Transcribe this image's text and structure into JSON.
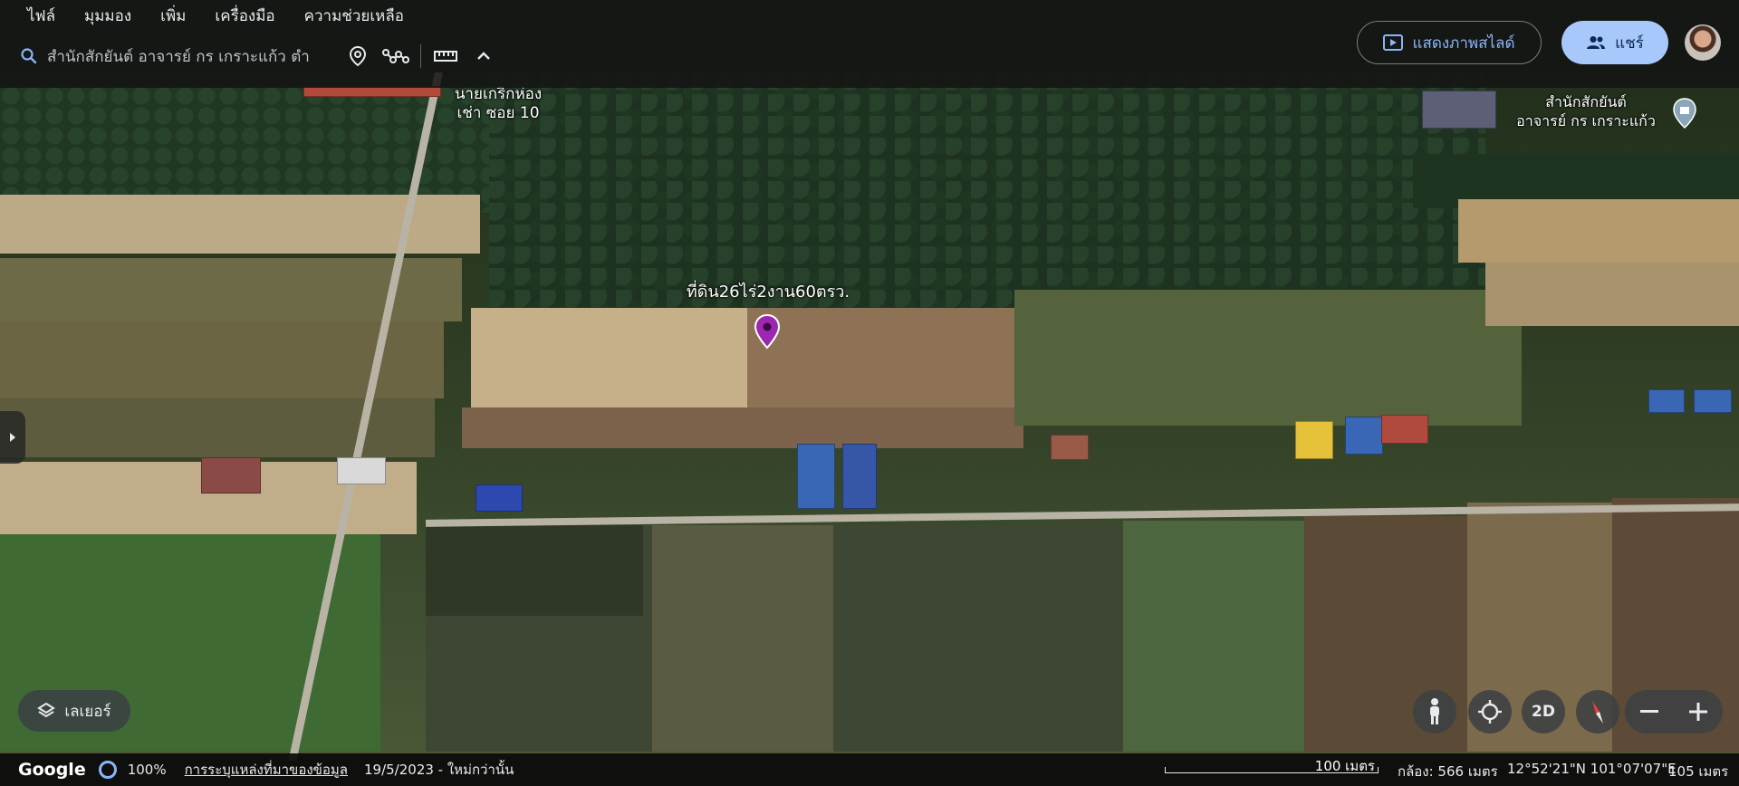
{
  "menu": {
    "items": [
      "ไฟล์",
      "มุมมอง",
      "เพิ่ม",
      "เครื่องมือ",
      "ความช่วยเหลือ"
    ]
  },
  "search": {
    "value": "สำนักสักยันต์ อาจารย์ กร เกราะแก้ว ตำ",
    "icons": [
      "search-icon",
      "location-pin-icon",
      "route-icon",
      "ruler-icon",
      "chevron-up-icon"
    ]
  },
  "header": {
    "slideshow_label": "แสดงภาพสไลด์",
    "share_label": "แชร์"
  },
  "map_labels": {
    "road_label": "นายเกริกห่อง\nเช่า ซอย 10",
    "poi_label": "สำนักสักยันต์\nอาจารย์ กร เกราะแก้ว",
    "pin_label": "ที่ดิน26ไร่2งาน60ตรว."
  },
  "controls": {
    "layers_label": "เลเยอร์",
    "view_2d_label": "2D",
    "icons": [
      "street-view-icon",
      "my-location-icon",
      "compass-icon",
      "zoom-out-icon",
      "zoom-in-icon"
    ]
  },
  "status": {
    "brand": "Google",
    "load_percent": "100%",
    "data_sources": "การระบุแหล่งที่มาของข้อมูล",
    "imagery_date": "19/5/2023 - ใหม่กว่านั้น",
    "scale": "100 เมตร",
    "camera": "กล้อง: 566 เมตร",
    "coordinates": "12°52'21\"N 101°07'07\"E",
    "elevation": "105 เมตร"
  },
  "colors": {
    "pin": "#9c27b0",
    "accent": "#8ab4f8",
    "share_bg": "#a8c7fa"
  }
}
